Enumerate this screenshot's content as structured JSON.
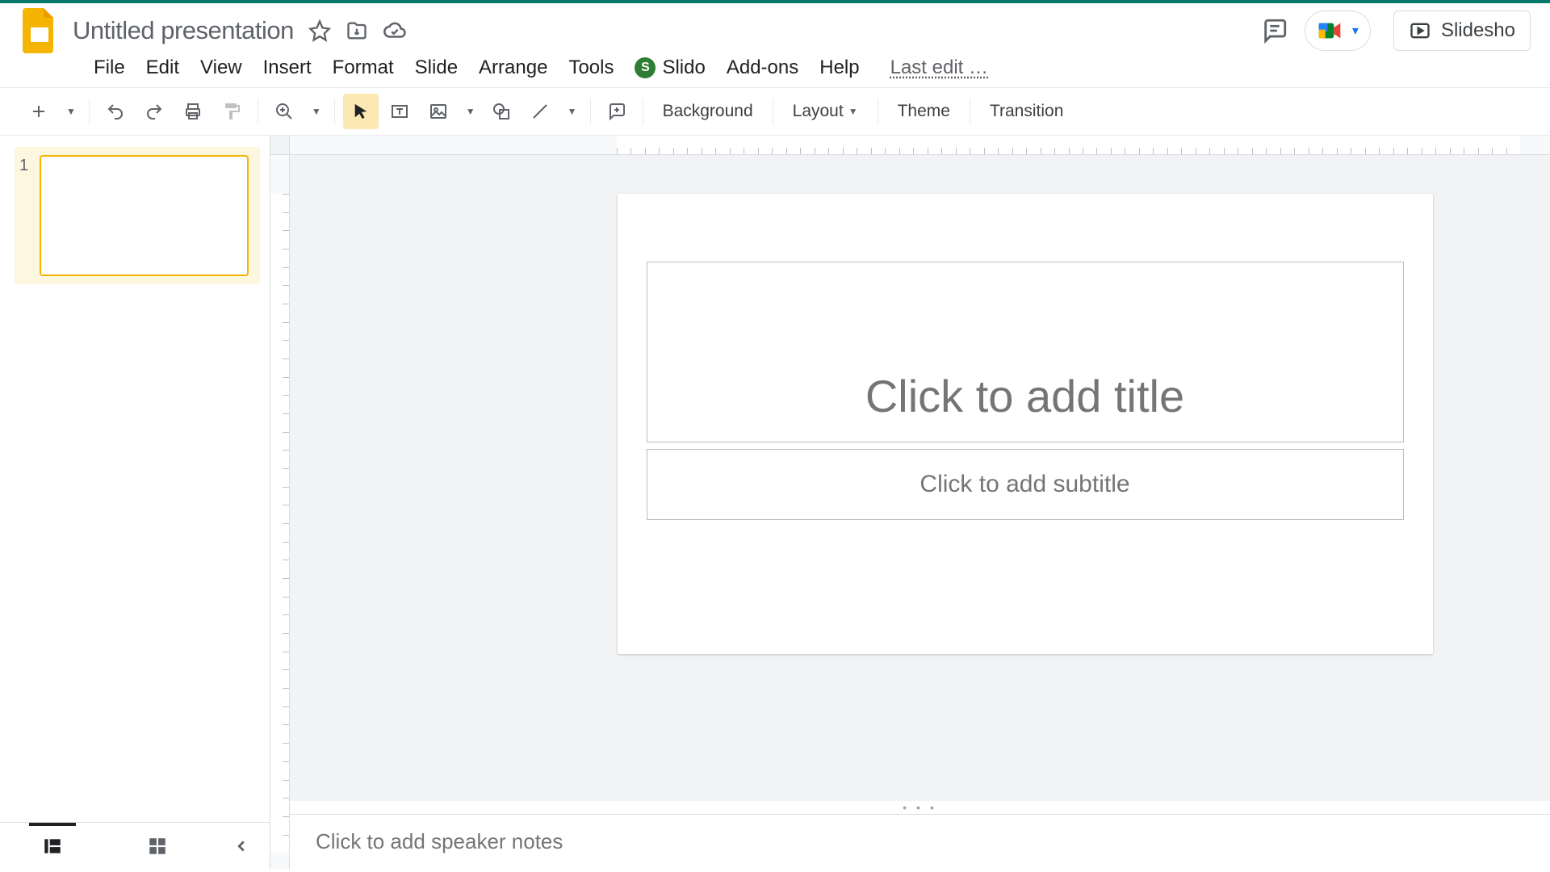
{
  "doc": {
    "title": "Untitled presentation"
  },
  "menus": {
    "file": "File",
    "edit": "Edit",
    "view": "View",
    "insert": "Insert",
    "format": "Format",
    "slide": "Slide",
    "arrange": "Arrange",
    "tools": "Tools",
    "slido": "Slido",
    "addons": "Add-ons",
    "help": "Help",
    "lastedit": "Last edit …"
  },
  "toolbar": {
    "background": "Background",
    "layout": "Layout",
    "theme": "Theme",
    "transition": "Transition"
  },
  "slideshow": {
    "label": "Slidesho"
  },
  "slide": {
    "number": "1",
    "title_placeholder": "Click to add title",
    "subtitle_placeholder": "Click to add subtitle"
  },
  "notes": {
    "placeholder": "Click to add speaker notes"
  },
  "slido_badge": "S"
}
